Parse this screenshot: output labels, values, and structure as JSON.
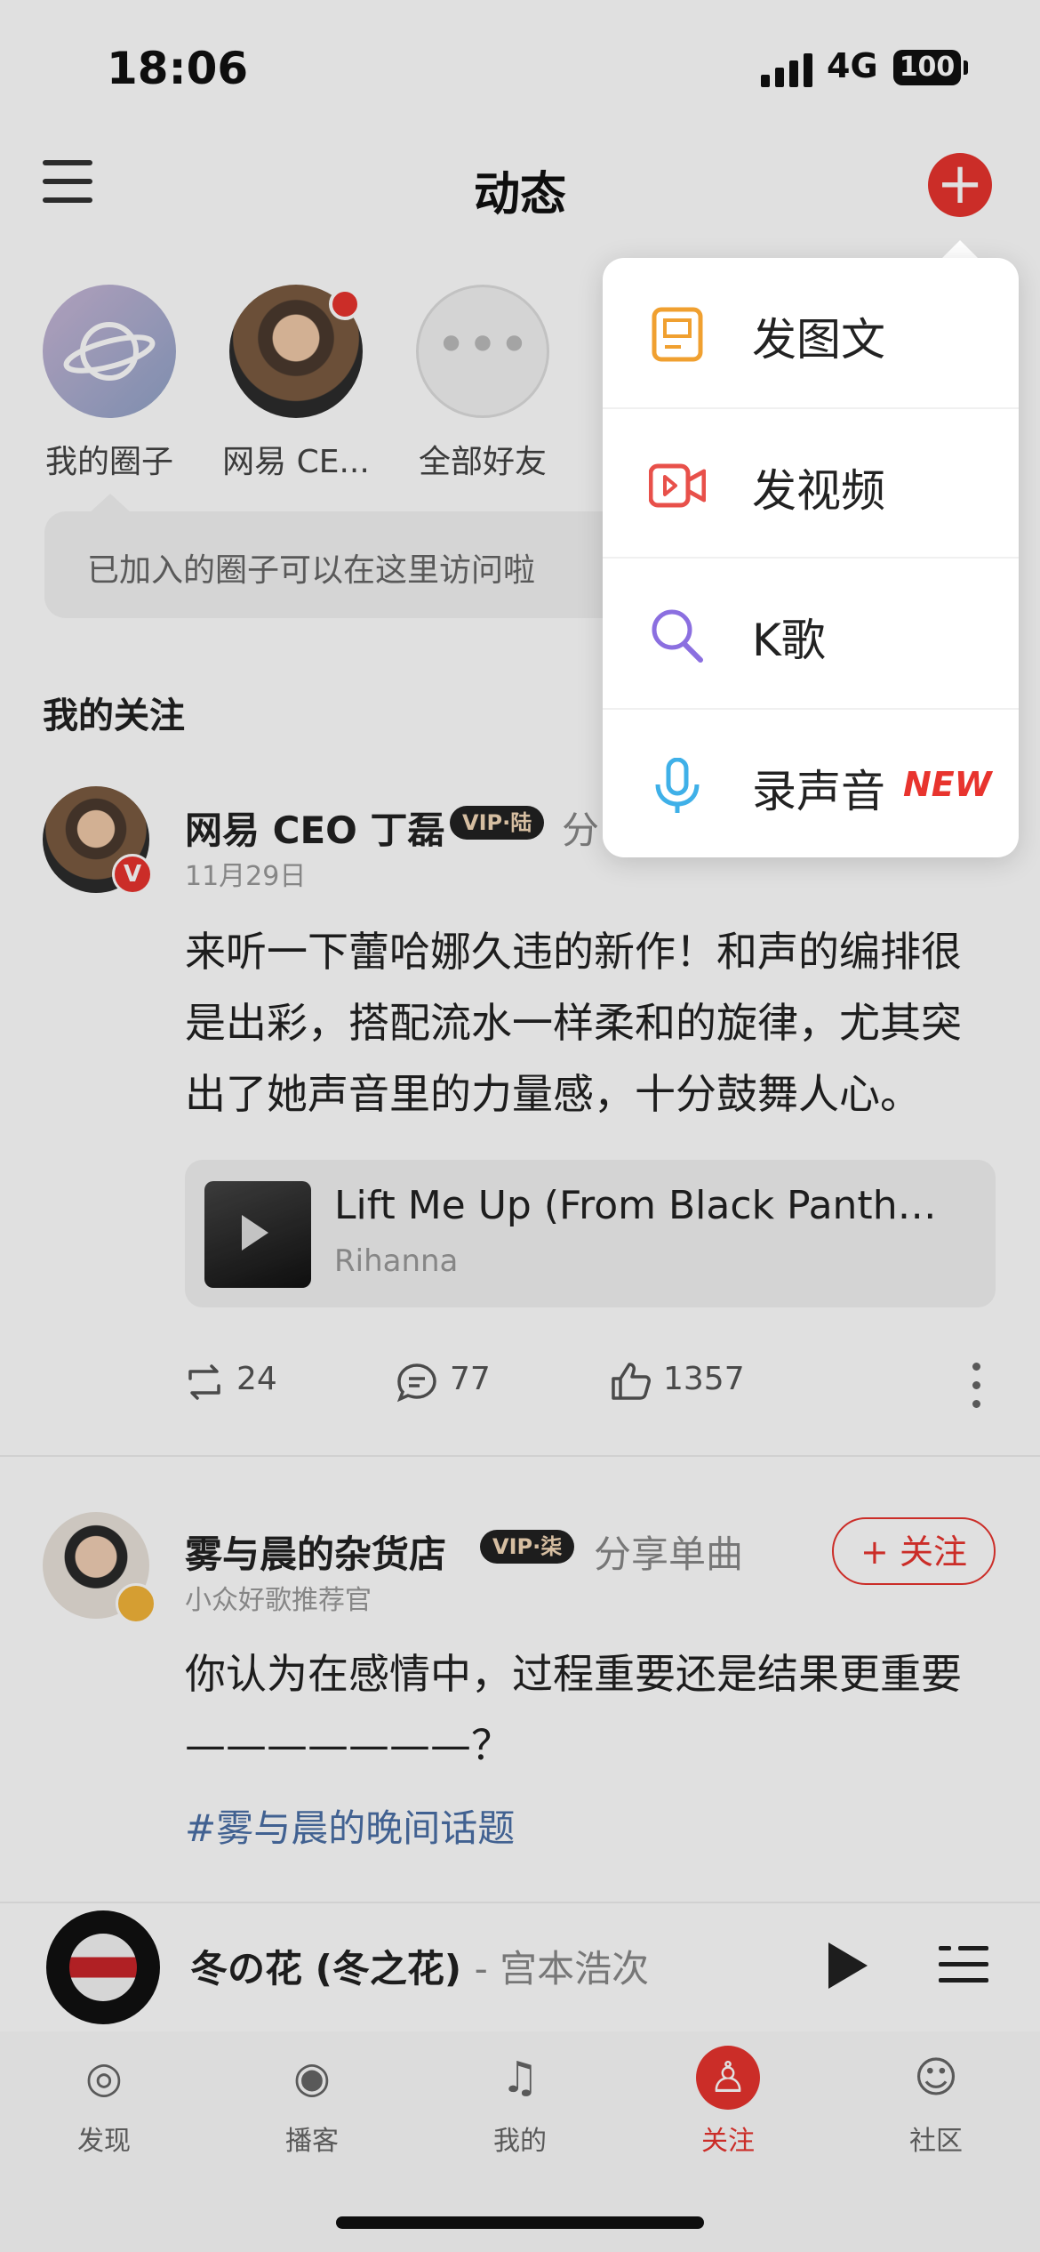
{
  "status_bar": {
    "time": "18:06",
    "network": "4G",
    "battery": "100"
  },
  "header": {
    "title": "动态"
  },
  "stories": [
    {
      "label": "我的圈子"
    },
    {
      "label": "网易 CE..."
    },
    {
      "label": "全部好友"
    }
  ],
  "tooltip": {
    "text": "已加入的圈子可以在这里访问啦"
  },
  "section": {
    "title": "我的关注"
  },
  "post1": {
    "author": "网易 CEO 丁磊",
    "vip": "VIP·陆",
    "action": "分",
    "date": "11月29日",
    "body_lines": [
      "来听一下蕾哈娜久违的新作！和声的编排很",
      "是出彩，搭配流水一样柔和的旋律，尤其突",
      "出了她声音里的力量感，十分鼓舞人心。"
    ],
    "song": {
      "title": "Lift Me Up (From Black Panther:...",
      "artist": "Rihanna"
    },
    "counts": {
      "repost": "24",
      "comment": "77",
      "like": "1357"
    }
  },
  "post2": {
    "author": "雾与晨的杂货店",
    "vip": "VIP·柒",
    "action": "分享单曲",
    "subtitle": "小众好歌推荐官",
    "follow_label": "+ 关注",
    "body_lines": [
      "你认为在感情中，过程重要还是结果更重要",
      "———————？"
    ],
    "topic": "#雾与晨的晚间话题"
  },
  "player": {
    "title": "冬の花 (冬之花)",
    "artist": "- 宫本浩次"
  },
  "tabs": [
    {
      "label": "发现",
      "icon": "discover-icon"
    },
    {
      "label": "播客",
      "icon": "podcast-icon"
    },
    {
      "label": "我的",
      "icon": "music-note-icon"
    },
    {
      "label": "关注",
      "icon": "follow-icon",
      "active": true
    },
    {
      "label": "社区",
      "icon": "community-icon"
    }
  ],
  "popup_menu": {
    "items": [
      {
        "label": "发图文",
        "icon": "image-text-icon",
        "color": "#f0a030"
      },
      {
        "label": "发视频",
        "icon": "video-icon",
        "color": "#e8504a"
      },
      {
        "label": "K歌",
        "icon": "karaoke-mic-icon",
        "color": "#8b6fe0"
      },
      {
        "label": "录声音",
        "icon": "microphone-icon",
        "color": "#3fb0e8",
        "badge": "NEW"
      }
    ]
  },
  "colors": {
    "accent": "#e8342e",
    "topic_link": "#4a6fa5"
  }
}
